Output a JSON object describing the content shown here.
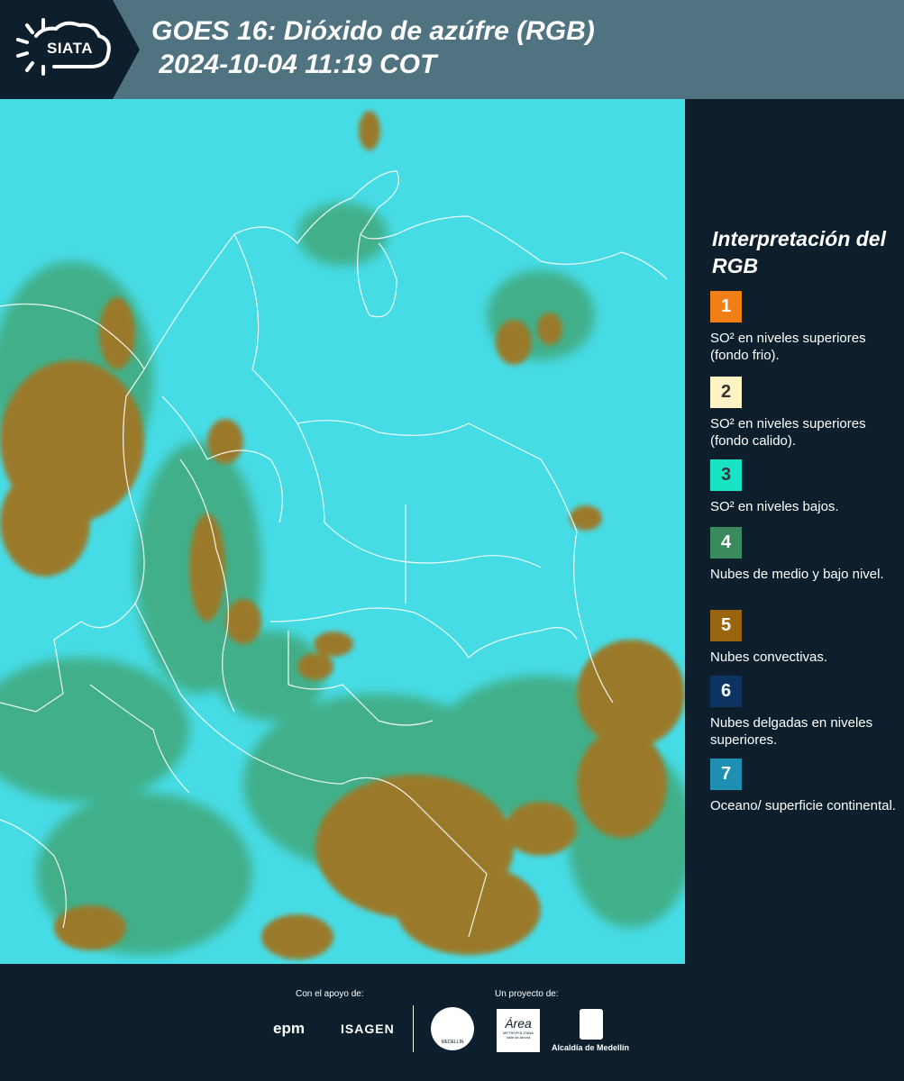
{
  "header": {
    "brand": "SIATA",
    "title": "GOES 16: Dióxido de azúfre (RGB)\n 2024-10-04 11:19 COT"
  },
  "legend": {
    "title": "Interpretación del RGB",
    "items": [
      {
        "num": "1",
        "label": "SO² en niveles superiores (fondo frio).",
        "color": "#f07f15",
        "text_color": "#ffffff"
      },
      {
        "num": "2",
        "label": "SO² en niveles superiores (fondo calido).",
        "color": "#fdf3c4",
        "text_color": "#333333"
      },
      {
        "num": "3",
        "label": "SO² en niveles bajos.",
        "color": "#19e3c4",
        "text_color": "#333333"
      },
      {
        "num": "4",
        "label": "Nubes de medio y bajo nivel.",
        "color": "#3b8a5e",
        "text_color": "#ffffff"
      },
      {
        "num": "5",
        "label": "Nubes convectivas.",
        "color": "#98650e",
        "text_color": "#ffffff"
      },
      {
        "num": "6",
        "label": "Nubes delgadas en niveles superiores.",
        "color": "#0d3460",
        "text_color": "#ffffff"
      },
      {
        "num": "7",
        "label": "Oceano/ superficie continental.",
        "color": "#1e90b3",
        "text_color": "#ffffff"
      }
    ]
  },
  "footer": {
    "support_label": "Con el apoyo de:",
    "project_label": "Un proyecto de:",
    "sponsor_1": "epm",
    "sponsor_2": "ISAGEN",
    "partner_1": "MEDELLÍN",
    "partner_2_a": "Área",
    "partner_2_b": "METROPOLITANA",
    "partner_2_c": "Valle de Aburrá",
    "partner_3": "Alcaldía de Medellín"
  },
  "map": {
    "description_colors": {
      "sky": "#44dde7",
      "cloud_brown": "#9a7a2c",
      "cloud_green": "#3fa06a",
      "border": "#ffffff"
    }
  }
}
